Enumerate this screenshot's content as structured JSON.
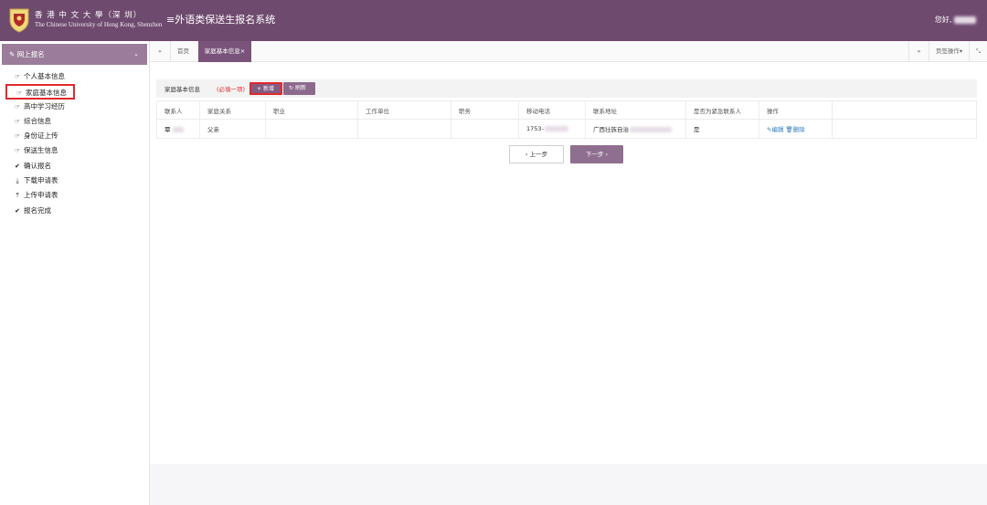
{
  "brand": {
    "name_cn": "香 港 中 文 大 學（深 圳）",
    "name_en": "The Chinese University of Hong Kong, Shenzhen",
    "logo_icon": "crest-icon"
  },
  "header": {
    "system_title": "≡外语类保送生报名系统",
    "greeting": "您好,"
  },
  "sidebar": {
    "section_label": "网上报名",
    "section_icon": "edit-icon",
    "items": [
      {
        "label": "个人基本信息",
        "icon": "hand-pointer-icon"
      },
      {
        "label": "家庭基本信息",
        "icon": "hand-pointer-icon",
        "active": true
      },
      {
        "label": "高中学习经历",
        "icon": "hand-pointer-icon"
      },
      {
        "label": "综合信息",
        "icon": "hand-pointer-icon"
      },
      {
        "label": "身份证上传",
        "icon": "hand-pointer-icon"
      },
      {
        "label": "保送生信息",
        "icon": "hand-pointer-icon"
      },
      {
        "label": "确认报名",
        "icon": "check-icon"
      },
      {
        "label": "下载申请表",
        "icon": "download-icon"
      },
      {
        "label": "上传申请表",
        "icon": "upload-icon"
      },
      {
        "label": "报名完成",
        "icon": "check-icon"
      }
    ]
  },
  "tabs": {
    "home": "首页",
    "active": "家庭基本信息",
    "page_ops": "页签操作"
  },
  "panel": {
    "title": "家庭基本信息",
    "required_note": "(必填一项)",
    "add_button": "新增",
    "refresh_button": "刷新"
  },
  "table": {
    "columns": [
      "联系人",
      "家庭关系",
      "职业",
      "工作单位",
      "职务",
      "移动电话",
      "联系地址",
      "是否为紧急联系人",
      "操作"
    ],
    "rows": [
      {
        "name": "覃",
        "relation": "父亲",
        "job": "",
        "employer": "",
        "position": "",
        "phone": "1753-",
        "address": "广西壮族自治",
        "emergency": "是",
        "edit": "编辑",
        "delete": "删除"
      }
    ]
  },
  "nav": {
    "prev": "上一步",
    "next": "下一步"
  },
  "colors": {
    "header_bg": "#6f4a6f",
    "accent": "#8c6a8c",
    "highlight_border": "#e0282c",
    "link": "#2f7cc0"
  }
}
